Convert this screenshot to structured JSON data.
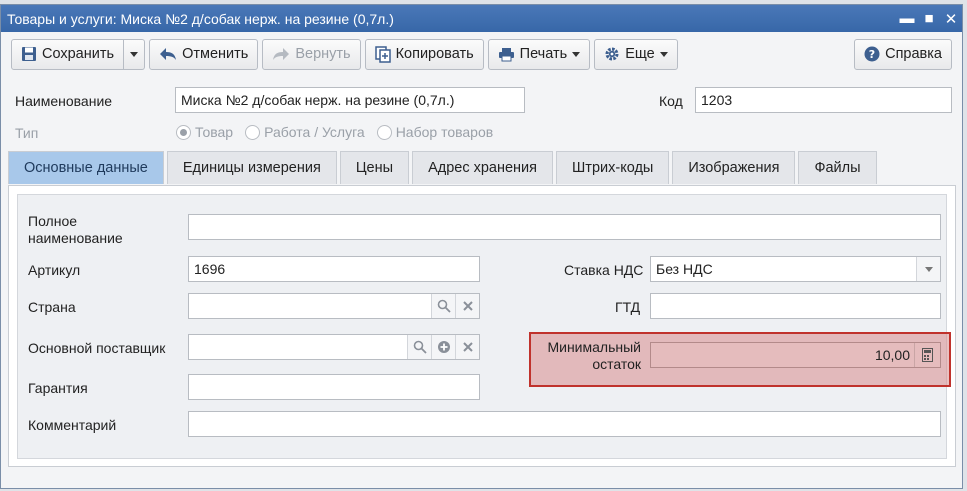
{
  "window": {
    "title": "Товары и услуги: Миска №2 д/собак нерж. на резине (0,7л.)"
  },
  "toolbar": {
    "save_label": "Сохранить",
    "cancel_label": "Отменить",
    "redo_label": "Вернуть",
    "copy_label": "Копировать",
    "print_label": "Печать",
    "more_label": "Еще",
    "help_label": "Справка"
  },
  "header": {
    "name_label": "Наименование",
    "name_value": "Миска №2 д/собак нерж. на резине (0,7л.)",
    "code_label": "Код",
    "code_value": "1203",
    "type_label": "Тип",
    "type_options": [
      "Товар",
      "Работа / Услуга",
      "Набор товаров"
    ],
    "type_selected": "Товар"
  },
  "tabs": [
    "Основные данные",
    "Единицы измерения",
    "Цены",
    "Адрес хранения",
    "Штрих-коды",
    "Изображения",
    "Файлы"
  ],
  "form": {
    "full_name_label_1": "Полное",
    "full_name_label_2": "наименование",
    "full_name_value": "",
    "article_label": "Артикул",
    "article_value": "1696",
    "country_label": "Страна",
    "country_value": "",
    "supplier_label": "Основной поставщик",
    "supplier_value": "",
    "warranty_label": "Гарантия",
    "warranty_value": "",
    "comment_label": "Комментарий",
    "comment_value": "",
    "vat_label": "Ставка НДС",
    "vat_value": "Без НДС",
    "gtd_label": "ГТД",
    "gtd_value": "",
    "min_stock_label_1": "Минимальный",
    "min_stock_label_2": "остаток",
    "min_stock_value": "10,00"
  },
  "colors": {
    "titlebar": "#3f6fb0",
    "active_tab": "#a8c8ea",
    "highlight_border": "#c0322c"
  }
}
